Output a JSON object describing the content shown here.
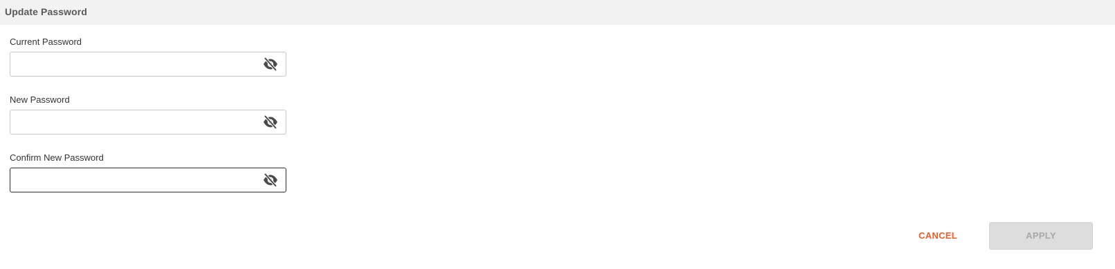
{
  "header": {
    "title": "Update Password"
  },
  "form": {
    "current_password": {
      "label": "Current Password",
      "value": "",
      "icon": "eye-slash-icon"
    },
    "new_password": {
      "label": "New Password",
      "value": "",
      "icon": "eye-slash-icon"
    },
    "confirm_password": {
      "label": "Confirm New Password",
      "value": "",
      "icon": "eye-slash-icon"
    }
  },
  "actions": {
    "cancel_label": "CANCEL",
    "apply_label": "APPLY",
    "apply_enabled": false
  },
  "colors": {
    "accent": "#f15a24",
    "header_bg": "#f2f2f2",
    "disabled_bg": "#dddddd",
    "icon": "#4a4a4a"
  }
}
